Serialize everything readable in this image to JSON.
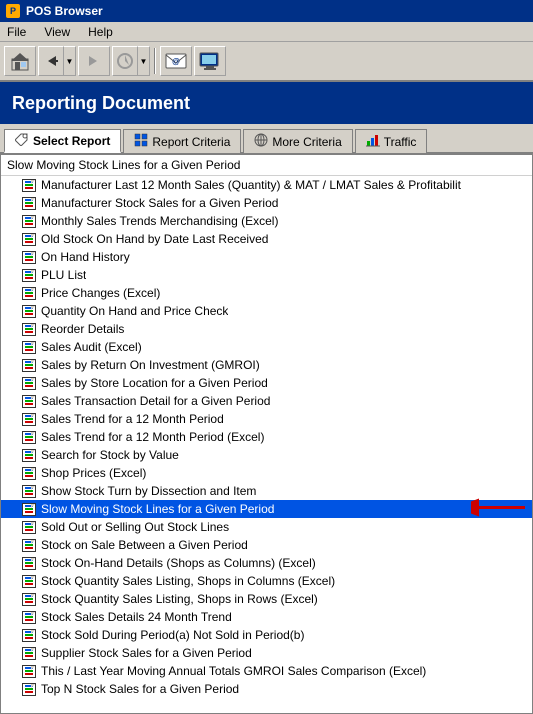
{
  "titleBar": {
    "icon": "P",
    "title": "POS Browser"
  },
  "menuBar": {
    "items": [
      "File",
      "View",
      "Help"
    ]
  },
  "toolbar": {
    "buttons": [
      {
        "name": "home",
        "symbol": "🏠"
      },
      {
        "name": "back",
        "symbol": "◀"
      },
      {
        "name": "forward",
        "symbol": "▶"
      },
      {
        "name": "stop",
        "symbol": "⬆"
      },
      {
        "name": "email",
        "symbol": "@"
      },
      {
        "name": "computer",
        "symbol": "🖥"
      }
    ]
  },
  "pageHeading": "Reporting Document",
  "tabs": [
    {
      "id": "select-report",
      "label": "Select Report",
      "active": true,
      "icon": "tag"
    },
    {
      "id": "report-criteria",
      "label": "Report Criteria",
      "active": false,
      "icon": "grid"
    },
    {
      "id": "more-criteria",
      "label": "More Criteria",
      "active": false,
      "icon": "globe"
    },
    {
      "id": "traffic",
      "label": "Traffic",
      "active": false,
      "icon": "chart"
    }
  ],
  "sectionHeader": "Slow Moving Stock Lines for a Given Period",
  "listItems": [
    {
      "text": "Manufacturer Last 12 Month Sales (Quantity) & MAT / LMAT Sales & Profitabilit",
      "selected": false
    },
    {
      "text": "Manufacturer Stock Sales for a Given Period",
      "selected": false
    },
    {
      "text": "Monthly Sales Trends Merchandising (Excel)",
      "selected": false
    },
    {
      "text": "Old Stock On Hand by Date Last Received",
      "selected": false
    },
    {
      "text": "On Hand History",
      "selected": false
    },
    {
      "text": "PLU List",
      "selected": false
    },
    {
      "text": "Price Changes (Excel)",
      "selected": false
    },
    {
      "text": "Quantity On Hand and Price Check",
      "selected": false
    },
    {
      "text": "Reorder Details",
      "selected": false
    },
    {
      "text": "Sales Audit (Excel)",
      "selected": false
    },
    {
      "text": "Sales by Return On Investment (GMROI)",
      "selected": false
    },
    {
      "text": "Sales by Store Location for a Given Period",
      "selected": false
    },
    {
      "text": "Sales Transaction Detail for a Given Period",
      "selected": false
    },
    {
      "text": "Sales Trend for a 12 Month Period",
      "selected": false
    },
    {
      "text": "Sales Trend for a 12 Month Period (Excel)",
      "selected": false
    },
    {
      "text": "Search for Stock by Value",
      "selected": false
    },
    {
      "text": "Shop Prices (Excel)",
      "selected": false
    },
    {
      "text": "Show Stock Turn by Dissection and Item",
      "selected": false
    },
    {
      "text": "Slow Moving Stock Lines for a Given Period",
      "selected": true,
      "arrow": true
    },
    {
      "text": "Sold Out or Selling Out Stock Lines",
      "selected": false
    },
    {
      "text": "Stock on Sale Between a Given Period",
      "selected": false
    },
    {
      "text": "Stock On-Hand Details (Shops as Columns) (Excel)",
      "selected": false
    },
    {
      "text": "Stock Quantity Sales Listing, Shops in Columns (Excel)",
      "selected": false
    },
    {
      "text": "Stock Quantity Sales Listing, Shops in Rows (Excel)",
      "selected": false
    },
    {
      "text": "Stock Sales Details 24 Month Trend",
      "selected": false
    },
    {
      "text": "Stock Sold During Period(a) Not Sold in Period(b)",
      "selected": false
    },
    {
      "text": "Supplier Stock Sales for a Given Period",
      "selected": false
    },
    {
      "text": "This / Last Year Moving Annual Totals GMROI Sales Comparison (Excel)",
      "selected": false
    },
    {
      "text": "Top N Stock Sales for a Given Period",
      "selected": false
    }
  ]
}
